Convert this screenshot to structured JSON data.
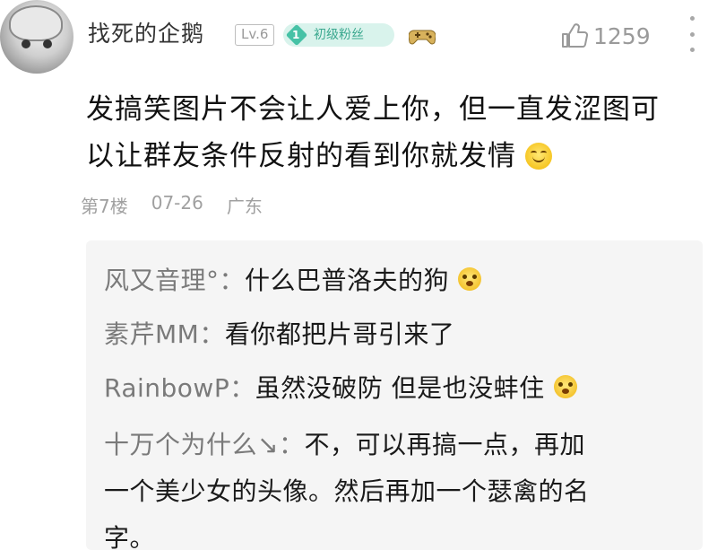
{
  "comment": {
    "author": {
      "name": "找死的企鹅",
      "level": "Lv.6",
      "fan_badge": {
        "level": "1",
        "label": "初级粉丝",
        "color": "#46c2a6"
      },
      "extra_icon": "gamepad-icon"
    },
    "likes": {
      "count": "1259",
      "icon": "thumb-up-icon"
    },
    "more_icon": "more-vertical-icon",
    "text_lines": [
      "发搞笑图片不会让人爱上你，但一直发涩图可",
      "以让群友条件反射的看到你就发情"
    ],
    "text_emoji": "smile-emoji",
    "floor": "第7楼",
    "date": "07-26",
    "location": "广东"
  },
  "replies": [
    {
      "author": "风又音理°",
      "separator": "：",
      "text": "什么巴普洛夫的狗",
      "emoji": "grin-emoji"
    },
    {
      "author": "素芹MM",
      "separator": "：",
      "text": "看你都把片哥引来了"
    },
    {
      "author": "RainbowP",
      "separator": "：",
      "text": "虽然没破防 但是也没蚌住",
      "emoji": "grin-emoji"
    },
    {
      "author": "十万个为什么↘",
      "separator": "：",
      "text_lines": [
        "不，可以再搞一点，再加",
        "一个美少女的头像。然后再加一个瑟禽的名",
        "字。"
      ]
    }
  ]
}
